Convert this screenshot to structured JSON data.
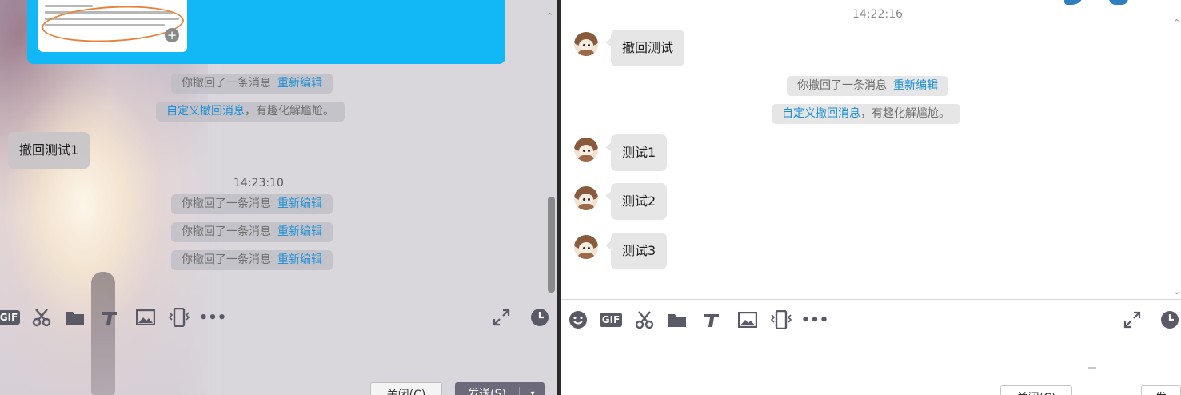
{
  "left": {
    "recall_notice": "你撤回了一条消息",
    "reedit": "重新编辑",
    "custom_link": "自定义撤回消息",
    "custom_text": "，有趣化解尴尬。",
    "bubble_text": "撤回测试1",
    "timestamp": "14:23:10",
    "close_button": "关闭(C)",
    "send_button": "发送(S)"
  },
  "right": {
    "timestamp": "14:22:16",
    "bubbles": [
      "撤回测试",
      "测试1",
      "测试2",
      "测试3"
    ],
    "recall_notice": "你撤回了一条消息",
    "reedit": "重新编辑",
    "custom_link": "自定义撤回消息",
    "custom_text": "，有趣化解尴尬。",
    "close_button": "关闭(C)",
    "send_button": "发"
  },
  "icons": {
    "gif": "GIF",
    "more": "•••",
    "toolbar": [
      "emoji-icon",
      "gif-icon",
      "scissors-icon",
      "folder-icon",
      "music-icon",
      "image-icon",
      "phone-shake-icon",
      "more-icon",
      "expand-icon",
      "clock-icon"
    ]
  },
  "colors": {
    "link": "#1a8fd6",
    "card_blue": "#12b7f5",
    "send_btn": "#6c6a7a"
  }
}
